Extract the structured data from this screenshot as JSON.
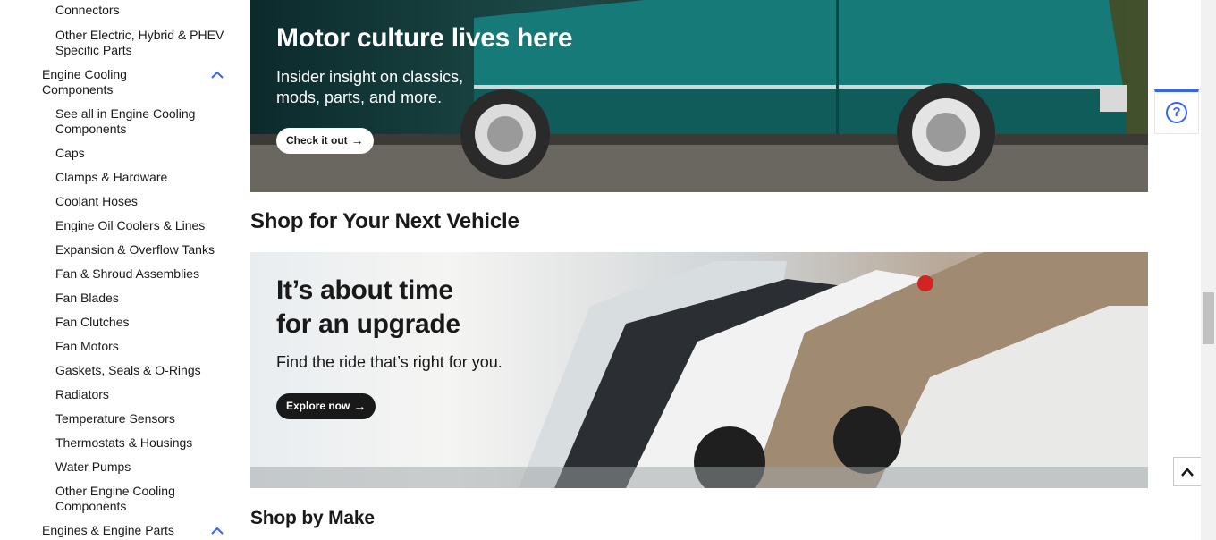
{
  "sidebar": {
    "top_partial": "Connectors",
    "other_electric": "Other Electric, Hybrid & PHEV Specific Parts",
    "engine_cooling": {
      "label": "Engine Cooling Components",
      "items": [
        "See all in Engine Cooling Components",
        "Caps",
        "Clamps & Hardware",
        "Coolant Hoses",
        "Engine Oil Coolers & Lines",
        "Expansion & Overflow Tanks",
        "Fan & Shroud Assemblies",
        "Fan Blades",
        "Fan Clutches",
        "Fan Motors",
        "Gaskets, Seals & O-Rings",
        "Radiators",
        "Temperature Sensors",
        "Thermostats & Housings",
        "Water Pumps",
        "Other Engine Cooling Components"
      ]
    },
    "engines": {
      "label": "Engines & Engine Parts"
    }
  },
  "banner_motor": {
    "title": "Motor culture lives here",
    "subtitle_line1": "Insider insight on classics,",
    "subtitle_line2": "mods, parts, and more.",
    "button": "Check it out"
  },
  "next_vehicle": {
    "heading": "Shop for Your Next Vehicle",
    "title_line1": "It’s about time",
    "title_line2": "for an upgrade",
    "subtitle": "Find the ride that’s right for you.",
    "button": "Explore now"
  },
  "shop_by_make": {
    "heading": "Shop by Make"
  },
  "help": {
    "label": "?"
  },
  "colors": {
    "accent": "#3665f3",
    "text": "#191919"
  }
}
